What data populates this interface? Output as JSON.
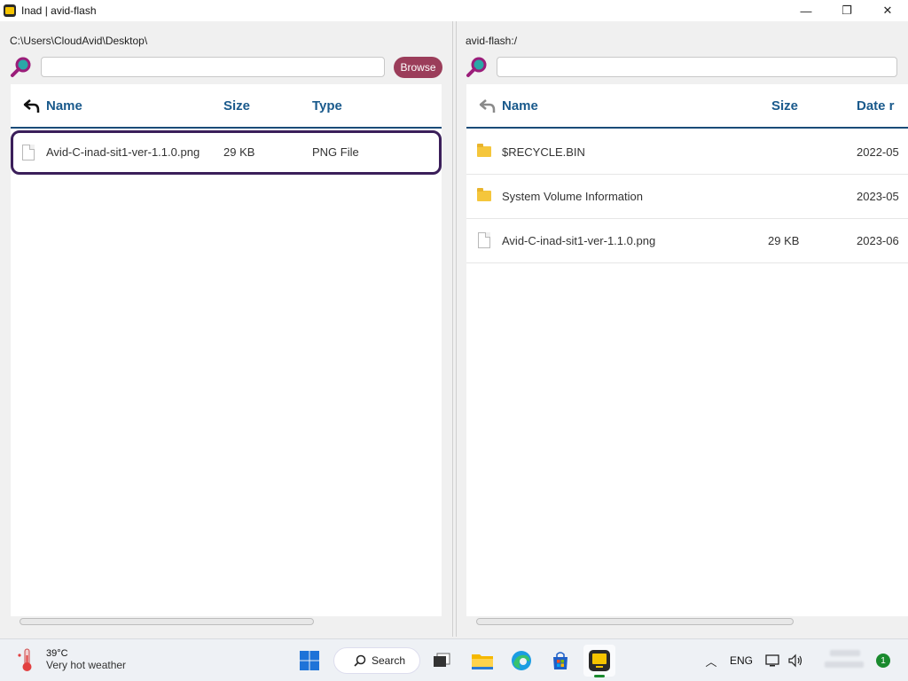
{
  "window": {
    "title": "Inad | avid-flash",
    "minimize_glyph": "—",
    "restore_glyph": "❐",
    "close_glyph": "✕"
  },
  "left_pane": {
    "path": "C:\\Users\\CloudAvid\\Desktop\\",
    "search_placeholder": "",
    "browse_label": "Browse",
    "columns": [
      "Name",
      "Size",
      "Type"
    ],
    "rows": [
      {
        "icon": "file-icon",
        "name": "Avid-C-inad-sit1-ver-1.1.0.png",
        "size": "29 KB",
        "type": "PNG File",
        "selected": true
      }
    ]
  },
  "right_pane": {
    "path": "avid-flash:/",
    "search_placeholder": "",
    "columns": [
      "Name",
      "Size",
      "Date r"
    ],
    "rows": [
      {
        "icon": "folder-icon",
        "name": "$RECYCLE.BIN",
        "size": "",
        "date": "2022-05"
      },
      {
        "icon": "folder-icon",
        "name": "System Volume Information",
        "size": "",
        "date": "2023-05"
      },
      {
        "icon": "file-icon",
        "name": "Avid-C-inad-sit1-ver-1.1.0.png",
        "size": "29 KB",
        "date": "2023-06"
      }
    ]
  },
  "taskbar": {
    "weather_temp": "39°C",
    "weather_desc": "Very hot weather",
    "search_label": "Search",
    "language": "ENG",
    "notification_count": "1",
    "tray_chevron": "︿"
  },
  "colors": {
    "accent_header": "#1a5a8c",
    "browse_button": "#9b3d5a",
    "selection_border": "#3b1f5a",
    "folder": "#f5c63c"
  }
}
